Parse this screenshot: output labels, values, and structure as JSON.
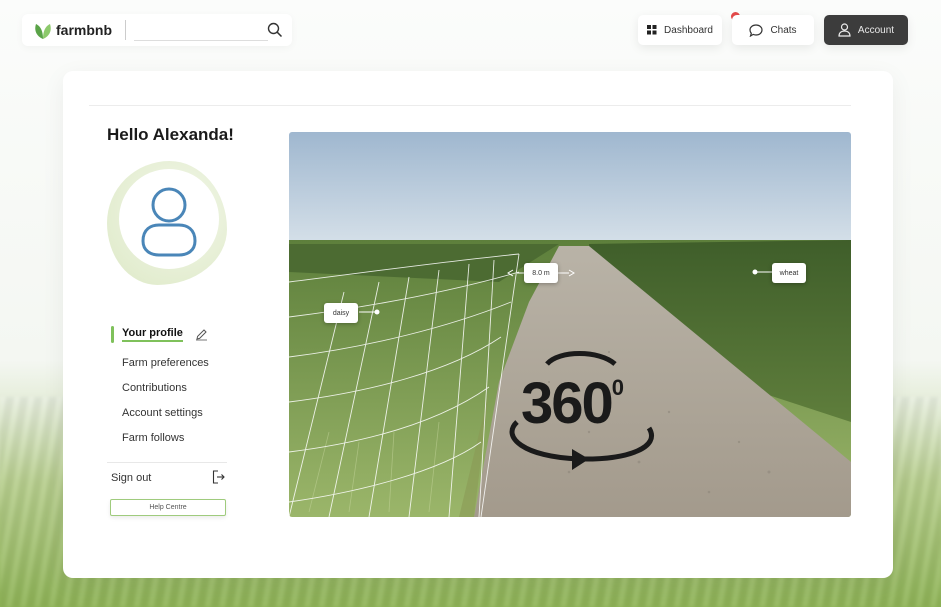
{
  "brand": {
    "name": "farmbnb"
  },
  "search": {
    "placeholder": ""
  },
  "nav": {
    "dashboard": "Dashboard",
    "chats": "Chats",
    "account": "Account"
  },
  "profile": {
    "greeting": "Hello Alexanda!",
    "menu": [
      "Your profile",
      "Farm preferences",
      "Contributions",
      "Account settings",
      "Farm follows"
    ],
    "sign_out": "Sign out",
    "help": "Help Centre"
  },
  "viewer": {
    "badge": "360",
    "badge_sup": "0",
    "tags": {
      "distance": "8.0 m",
      "left_crop": "daisy",
      "right_crop": "wheat"
    }
  },
  "colors": {
    "accent": "#7fc15b",
    "dark_button": "#3c3c3c",
    "notification": "#e44a4a",
    "icon_blue": "#4a86b8"
  }
}
